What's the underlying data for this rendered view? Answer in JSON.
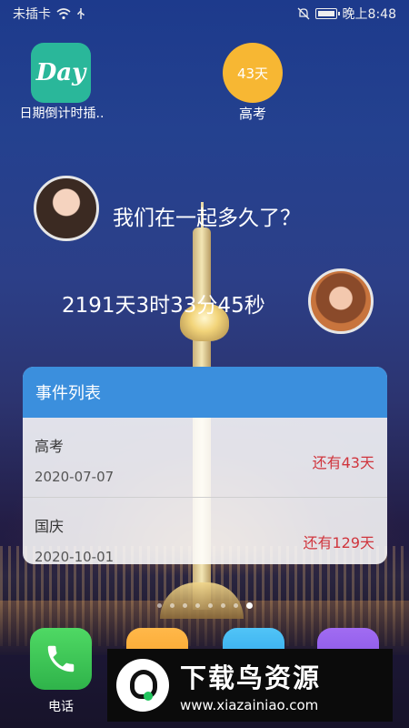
{
  "status_bar": {
    "carrier": "未插卡",
    "time": "晚上8:48"
  },
  "shortcuts": [
    {
      "tile_text": "Day",
      "label": "日期倒计时插.."
    },
    {
      "tile_text": "43天",
      "label": "高考"
    }
  ],
  "together_widget": {
    "question": "我们在一起多久了？",
    "duration": "2191天3时33分45秒"
  },
  "event_list": {
    "title": "事件列表",
    "events": [
      {
        "name": "高考",
        "date": "2020-07-07",
        "remaining": "还有43天"
      },
      {
        "name": "国庆",
        "date": "2020-10-01",
        "remaining": "还有129天"
      }
    ]
  },
  "page_indicator": {
    "pages": 8,
    "current": 8
  },
  "dock": {
    "phone_label": "电话"
  },
  "watermark": {
    "title": "下载鸟资源",
    "url": "www.xiazainiao.com"
  },
  "colors": {
    "card_header": "#3b8fdd",
    "remaining_text": "#d0353d",
    "countdown_badge": "#f7b733",
    "day_tile": "#2ab79a"
  }
}
